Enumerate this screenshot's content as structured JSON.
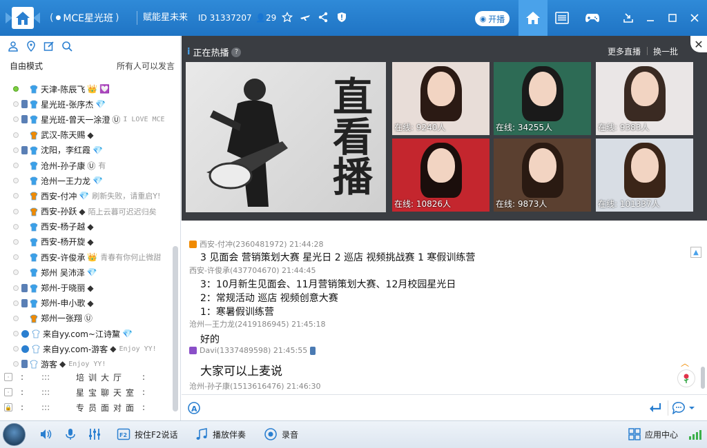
{
  "titlebar": {
    "channel": "MCE星光班",
    "slogan": "赋能星未来",
    "id_label": "ID 31337207",
    "online_count": "29",
    "kaibo": "开播"
  },
  "left": {
    "mode": "自由模式",
    "mode_right": "所有人可以发言",
    "users": [
      {
        "name": "天津-陈辰飞",
        "badge": "👑",
        "badge2": "💟",
        "msg": "",
        "online": true,
        "phone": false,
        "rank_color": "#3aa0e8"
      },
      {
        "name": "星光班-张序杰",
        "badge": "💎",
        "msg": "",
        "online": false,
        "phone": true,
        "rank_color": "#3aa0e8"
      },
      {
        "name": "星光班-曾天一涂澄",
        "badge": "Ⓤ",
        "msg": "I LOVE MCE",
        "mono": true,
        "online": false,
        "phone": true,
        "rank_color": "#3aa0e8"
      },
      {
        "name": "武汉-陈天赐",
        "badge": "◆",
        "msg": "",
        "online": false,
        "phone": false,
        "rank_color": "#f08a00"
      },
      {
        "name": "沈阳，李红霞",
        "badge": "💎",
        "msg": "",
        "online": false,
        "phone": true,
        "rank_color": "#3aa0e8"
      },
      {
        "name": "沧州-孙子康",
        "badge": "Ⓤ",
        "msg": "有",
        "online": false,
        "phone": false,
        "rank_color": "#3aa0e8"
      },
      {
        "name": "沧州一王力龙",
        "badge": "💎",
        "msg": "",
        "online": false,
        "phone": false,
        "rank_color": "#3aa0e8"
      },
      {
        "name": "西安-付冲",
        "badge": "💎",
        "msg": "刷新失败，请重启Y!",
        "online": false,
        "phone": false,
        "rank_color": "#f08a00"
      },
      {
        "name": "西安-孙跃",
        "badge": "◆",
        "msg": "陌上云暮可迟迟归矣",
        "online": false,
        "phone": false,
        "rank_color": "#f08a00"
      },
      {
        "name": "西安-杨子越",
        "badge": "◆",
        "msg": "",
        "online": false,
        "phone": false,
        "rank_color": "#3aa0e8"
      },
      {
        "name": "西安-杨开旋",
        "badge": "◆",
        "msg": "",
        "online": false,
        "phone": false,
        "rank_color": "#3aa0e8"
      },
      {
        "name": "西安-许俊承",
        "badge": "👑",
        "msg": "青春有你何止微甜",
        "online": false,
        "phone": false,
        "rank_color": "#3aa0e8"
      },
      {
        "name": "郑州 吴沛泽",
        "badge": "💎",
        "msg": "",
        "online": false,
        "phone": false,
        "rank_color": "#3aa0e8"
      },
      {
        "name": "郑州-于晓丽",
        "badge": "◆",
        "msg": "",
        "online": false,
        "phone": true,
        "rank_color": "#3aa0e8"
      },
      {
        "name": "郑州-申小歌",
        "badge": "◆",
        "msg": "",
        "online": false,
        "phone": true,
        "rank_color": "#3aa0e8"
      },
      {
        "name": "郑州一张翔",
        "badge": "Ⓤ",
        "msg": "",
        "online": false,
        "phone": false,
        "rank_color": "#f08a00"
      },
      {
        "name": "来自yy.com~江诗黧",
        "badge": "💎",
        "msg": "",
        "online": false,
        "phone": false,
        "yy": true,
        "rank_color": "#ffffff"
      },
      {
        "name": "来自yy.com-游客",
        "badge": "◆",
        "msg": "Enjoy YY!",
        "mono": true,
        "online": false,
        "phone": false,
        "yy": true,
        "rank_color": "#ffffff"
      },
      {
        "name": "游客",
        "badge": "◆",
        "msg": "Enjoy YY!",
        "mono": true,
        "online": false,
        "phone": true,
        "rank_color": "#ffffff"
      }
    ],
    "rooms": [
      {
        "box": "·",
        "sym": ":",
        "dots": ":::",
        "name": "培训大厅",
        "end": ":"
      },
      {
        "box": "·",
        "sym": ":",
        "dots": ":::",
        "name": "星宝聊天室",
        "end": ":"
      },
      {
        "box": "🔒",
        "sym": ":",
        "dots": ":::",
        "name": "专员面对面",
        "end": ":"
      }
    ]
  },
  "hot": {
    "title": "正在热播",
    "more": "更多直播",
    "swap": "换一批",
    "big_text": "直看播",
    "thumbs": [
      {
        "online": "在线: 9240人",
        "bg": "#e8ddd8",
        "hair": "#2b1a14"
      },
      {
        "online": "在线: 34255人",
        "bg": "#2d6b55",
        "hair": "#1a1a1a"
      },
      {
        "online": "在线: 9383人",
        "bg": "#eae6e6",
        "hair": "#3a2a22"
      },
      {
        "online": "在线: 10826人",
        "bg": "#c4262e",
        "hair": "#1b0e0c"
      },
      {
        "online": "在线: 9873人",
        "bg": "#5b4030",
        "hair": "#2a1a12"
      },
      {
        "online": "在线: 101337人",
        "bg": "#d8dde4",
        "hair": "#3b2518"
      }
    ]
  },
  "chat": {
    "messages": [
      {
        "head": "西安-付冲(2360481972) 21:44:28",
        "gift": "#f08a00"
      },
      {
        "line": "3   见面会  营销策划大赛   星光日     2    巡店  视频挑战赛  1    寒假训练营"
      },
      {
        "head": "西安-许俊承(437704670) 21:44:45"
      },
      {
        "line": "3：10月新生见面会、11月营销策划大赛、12月校园星光日"
      },
      {
        "line": "2：常规活动  巡店  视频创意大赛"
      },
      {
        "line": "1：寒暑假训练营"
      },
      {
        "head": "沧州—王力龙(2419186945) 21:45:18"
      },
      {
        "line": "好的"
      },
      {
        "head": "Davi(1337489598) 21:45:55",
        "gift": "#8a4fc8"
      },
      {
        "line": "大家可以上麦说"
      },
      {
        "head": "沧州-孙子康(1513616476) 21:46:30"
      }
    ]
  },
  "bottom": {
    "f2": "按住F2说话",
    "accomp": "播放伴奏",
    "record": "录音",
    "app_center": "应用中心"
  }
}
